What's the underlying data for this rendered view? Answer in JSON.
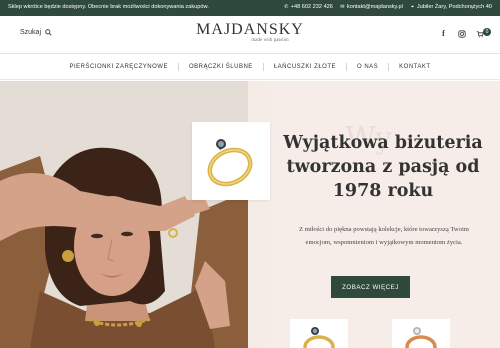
{
  "topbar": {
    "announcement": "Sklep wkrótce będzie dostępny. Obecnie brak możliwości dokonywania zakupów.",
    "phone": "+48 602 232 426",
    "email": "kontakt@majdansky.pl",
    "address": "Jubiler Żary, Podchorążych 40"
  },
  "header": {
    "search_label": "Szukaj",
    "brand": "MAJDANSKY",
    "tagline": "made with passion",
    "cart_count": "0"
  },
  "nav": {
    "items": [
      "PIERŚCIONKI ZARĘCZYNOWE",
      "OBRĄCZKI ŚLUBNE",
      "ŁAŃCUSZKI ZŁOTE",
      "O NAS",
      "KONTAKT"
    ]
  },
  "hero": {
    "ghost_text": "Wy",
    "title": "Wyjątkowa biżuteria tworzona z pasją od 1978 roku",
    "description": "Z miłości do piękna powstają kolekcje, które towarzyszą Twoim emocjom, wspomnieniom i wyjątkowym momentom życia.",
    "cta_label": "ZOBACZ WIĘCEJ"
  },
  "colors": {
    "brand_green": "#2f4a3d",
    "hero_bg": "#f5ece6",
    "gold": "#d9b24a"
  },
  "icons": [
    "search-icon",
    "facebook-icon",
    "instagram-icon",
    "cart-icon",
    "phone-icon",
    "mail-icon",
    "location-icon"
  ]
}
